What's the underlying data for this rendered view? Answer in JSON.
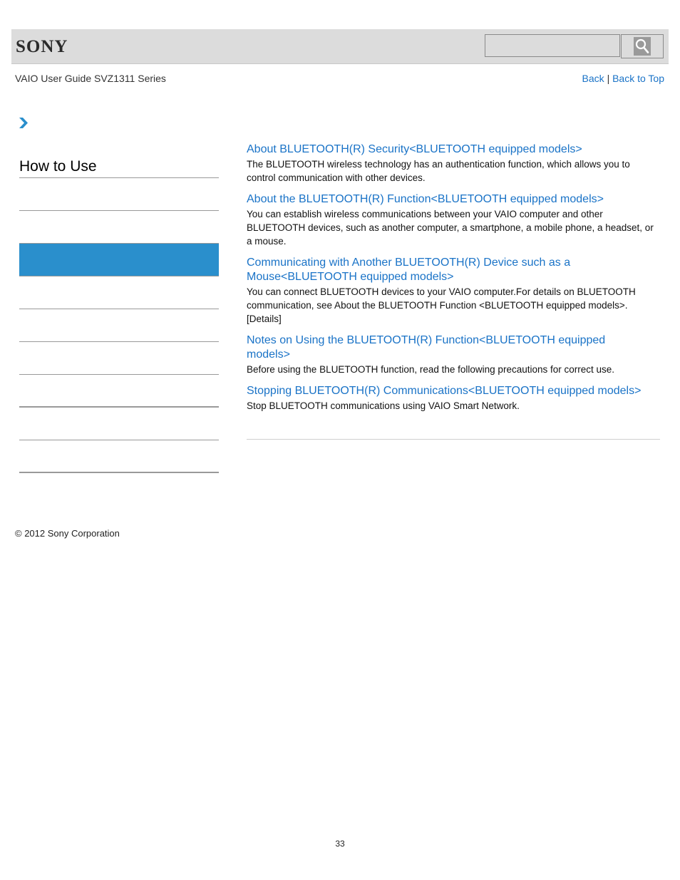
{
  "header": {
    "logo": "SONY",
    "search": {
      "value": "",
      "placeholder": ""
    },
    "search_icon": "magnifier-icon"
  },
  "subheader": {
    "guide_title": "VAIO User Guide SVZ1311 Series",
    "back_label": "Back",
    "separator": "|",
    "back_to_top_label": "Back to Top"
  },
  "breadcrumb": {
    "icon": "chevron-right-icon"
  },
  "sidebar": {
    "title": "How to Use",
    "items": [
      {
        "label": "",
        "active": false
      },
      {
        "label": "",
        "active": false
      },
      {
        "label": "",
        "active": true
      },
      {
        "label": "",
        "active": false
      },
      {
        "label": "",
        "active": false
      },
      {
        "label": "",
        "active": false
      },
      {
        "label": "",
        "active": false
      },
      {
        "label": "",
        "active": false
      },
      {
        "label": "",
        "active": false
      }
    ],
    "active_color": "#2a8fcc"
  },
  "content": {
    "entries": [
      {
        "title": "About BLUETOOTH(R) Security<BLUETOOTH equipped models>",
        "description": "The BLUETOOTH wireless technology has an authentication function, which allows you to control communication with other devices."
      },
      {
        "title": "About the BLUETOOTH(R) Function<BLUETOOTH equipped models>",
        "description": "You can establish wireless communications between your VAIO computer and other BLUETOOTH devices, such as another computer, a smartphone, a mobile phone, a headset, or a mouse."
      },
      {
        "title": "Communicating with Another BLUETOOTH(R) Device such as a Mouse<BLUETOOTH equipped models>",
        "description": "You can connect BLUETOOTH devices to your VAIO computer.For details on BLUETOOTH communication, see About the BLUETOOTH Function <BLUETOOTH equipped models>. [Details]"
      },
      {
        "title": "Notes on Using the BLUETOOTH(R) Function<BLUETOOTH equipped models>",
        "description": "Before using the BLUETOOTH function, read the following precautions for correct use."
      },
      {
        "title": "Stopping BLUETOOTH(R) Communications<BLUETOOTH equipped models>",
        "description": "Stop BLUETOOTH communications using VAIO Smart Network."
      }
    ]
  },
  "footer": {
    "copyright": "© 2012 Sony Corporation",
    "page_number": "33"
  },
  "colors": {
    "link": "#1a73c7",
    "header_bg": "#dcdcdc",
    "accent": "#2a8fcc"
  }
}
